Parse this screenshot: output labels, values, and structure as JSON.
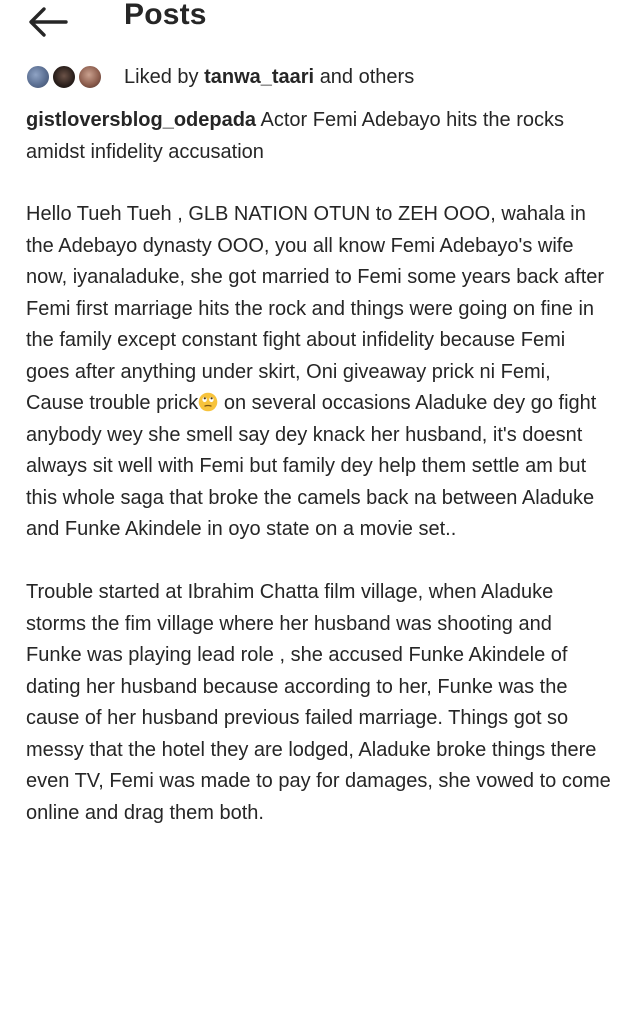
{
  "header": {
    "back_icon": "arrow-left-icon",
    "title": "Posts"
  },
  "likes": {
    "prefix": "Liked by",
    "user": "tanwa_taari",
    "suffix": "and others"
  },
  "post": {
    "author": "gistloversblog_odepada",
    "caption": "Actor Femi Adebayo hits the rocks amidst  infidelity accusation",
    "paragraph1_part1": "Hello Tueh Tueh , GLB NATION OTUN to ZEH OOO, wahala in the Adebayo dynasty OOO, you all know Femi Adebayo's wife now, iyanaladuke, she got married to Femi some years back after Femi first marriage hits the rock and things were going on fine in the family except constant fight about infidelity because Femi goes after anything under skirt, Oni giveaway prick ni Femi, Cause trouble prick",
    "paragraph1_emoji": "face-with-rolling-eyes-emoji",
    "paragraph1_part2": " on several occasions Aladuke dey go fight anybody wey she smell say dey knack her husband, it's doesnt always sit well with  Femi but family dey help them settle am but this whole saga that broke the camels back na between Aladuke and Funke Akindele in oyo state on a movie set..",
    "paragraph2": "Trouble started at Ibrahim Chatta film village, when Aladuke storms the fim village where her husband was shooting and Funke was playing lead role , she accused Funke Akindele of dating her husband because according to her, Funke was the cause of her husband previous failed marriage. Things got so messy  that the hotel they are lodged, Aladuke broke things there even TV, Femi was made to pay for damages, she vowed to come online and drag them both."
  },
  "colors": {
    "text": "#262626",
    "background": "#ffffff",
    "emoji": "#f7c33c"
  }
}
